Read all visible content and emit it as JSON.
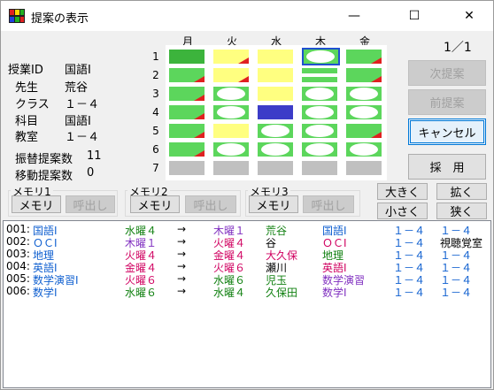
{
  "window": {
    "title": "提案の表示",
    "minimize": "—",
    "maximize": "☐",
    "close": "✕"
  },
  "colors": {
    "green": "#5cd65c",
    "yellow": "#ffff80",
    "gray": "#c0c0c0",
    "blue": "#3c3cc8",
    "red": "#e02020",
    "green_dark": "#3cb43c"
  },
  "info": {
    "class_id_label": "授業ID",
    "class_id_value": "国語Ⅰ",
    "teacher_label": "先生",
    "teacher_value": "荒谷",
    "class_label": "クラス",
    "class_value": "１－４",
    "subject_label": "科目",
    "subject_value": "国語Ⅰ",
    "room_label": "教室",
    "room_value": "１－４",
    "swap_count_label": "振替提案数",
    "swap_count_value": "11",
    "move_count_label": "移動提案数",
    "move_count_value": "0"
  },
  "grid": {
    "days": [
      "月",
      "火",
      "水",
      "木",
      "金"
    ],
    "periods": [
      "1",
      "2",
      "3",
      "4",
      "5",
      "6",
      "7"
    ]
  },
  "page_indicator": "1／1",
  "buttons": {
    "next": "次提案",
    "prev": "前提案",
    "cancel": "キャンセル",
    "adopt": "採　用",
    "bigger": "大きく",
    "smaller": "小さく",
    "widen": "拡く",
    "narrow": "狭く"
  },
  "memory": [
    {
      "title": "メモリ1",
      "store": "メモリ",
      "recall": "呼出し"
    },
    {
      "title": "メモリ2",
      "store": "メモリ",
      "recall": "呼出し"
    },
    {
      "title": "メモリ3",
      "store": "メモリ",
      "recall": "呼出し"
    }
  ],
  "proposals": [
    {
      "no": "001:",
      "subj": "国語Ⅰ",
      "from": "水曜４",
      "arrow": "→",
      "to": "木曜１",
      "teacher": "荒谷",
      "subj2": "国語Ⅰ",
      "class1": "１－４",
      "class2": "１－４",
      "extra": ""
    },
    {
      "no": "002:",
      "subj": "ＯＣⅠ",
      "from": "木曜１",
      "arrow": "→",
      "to": "火曜４",
      "teacher": "谷",
      "subj2": "ＯＣⅠ",
      "class1": "１－４",
      "class2": "",
      "extra": "視聴覚室"
    },
    {
      "no": "003:",
      "subj": "地理",
      "from": "火曜４",
      "arrow": "→",
      "to": "金曜４",
      "teacher": "大久保",
      "subj2": "地理",
      "class1": "１－４",
      "class2": "１－４",
      "extra": ""
    },
    {
      "no": "004:",
      "subj": "英語Ⅰ",
      "from": "金曜４",
      "arrow": "→",
      "to": "火曜６",
      "teacher": "瀬川",
      "subj2": "英語Ⅰ",
      "class1": "１－４",
      "class2": "１－４",
      "extra": ""
    },
    {
      "no": "005:",
      "subj": "数学演習Ⅰ",
      "from": "火曜６",
      "arrow": "→",
      "to": "水曜６",
      "teacher": "児玉",
      "subj2": "数学演習",
      "class1": "１－４",
      "class2": "１－４",
      "extra": ""
    },
    {
      "no": "006:",
      "subj": "数学Ⅰ",
      "from": "水曜６",
      "arrow": "→",
      "to": "水曜４",
      "teacher": "久保田",
      "subj2": "数学Ⅰ",
      "class1": "１－４",
      "class2": "１－４",
      "extra": ""
    }
  ]
}
